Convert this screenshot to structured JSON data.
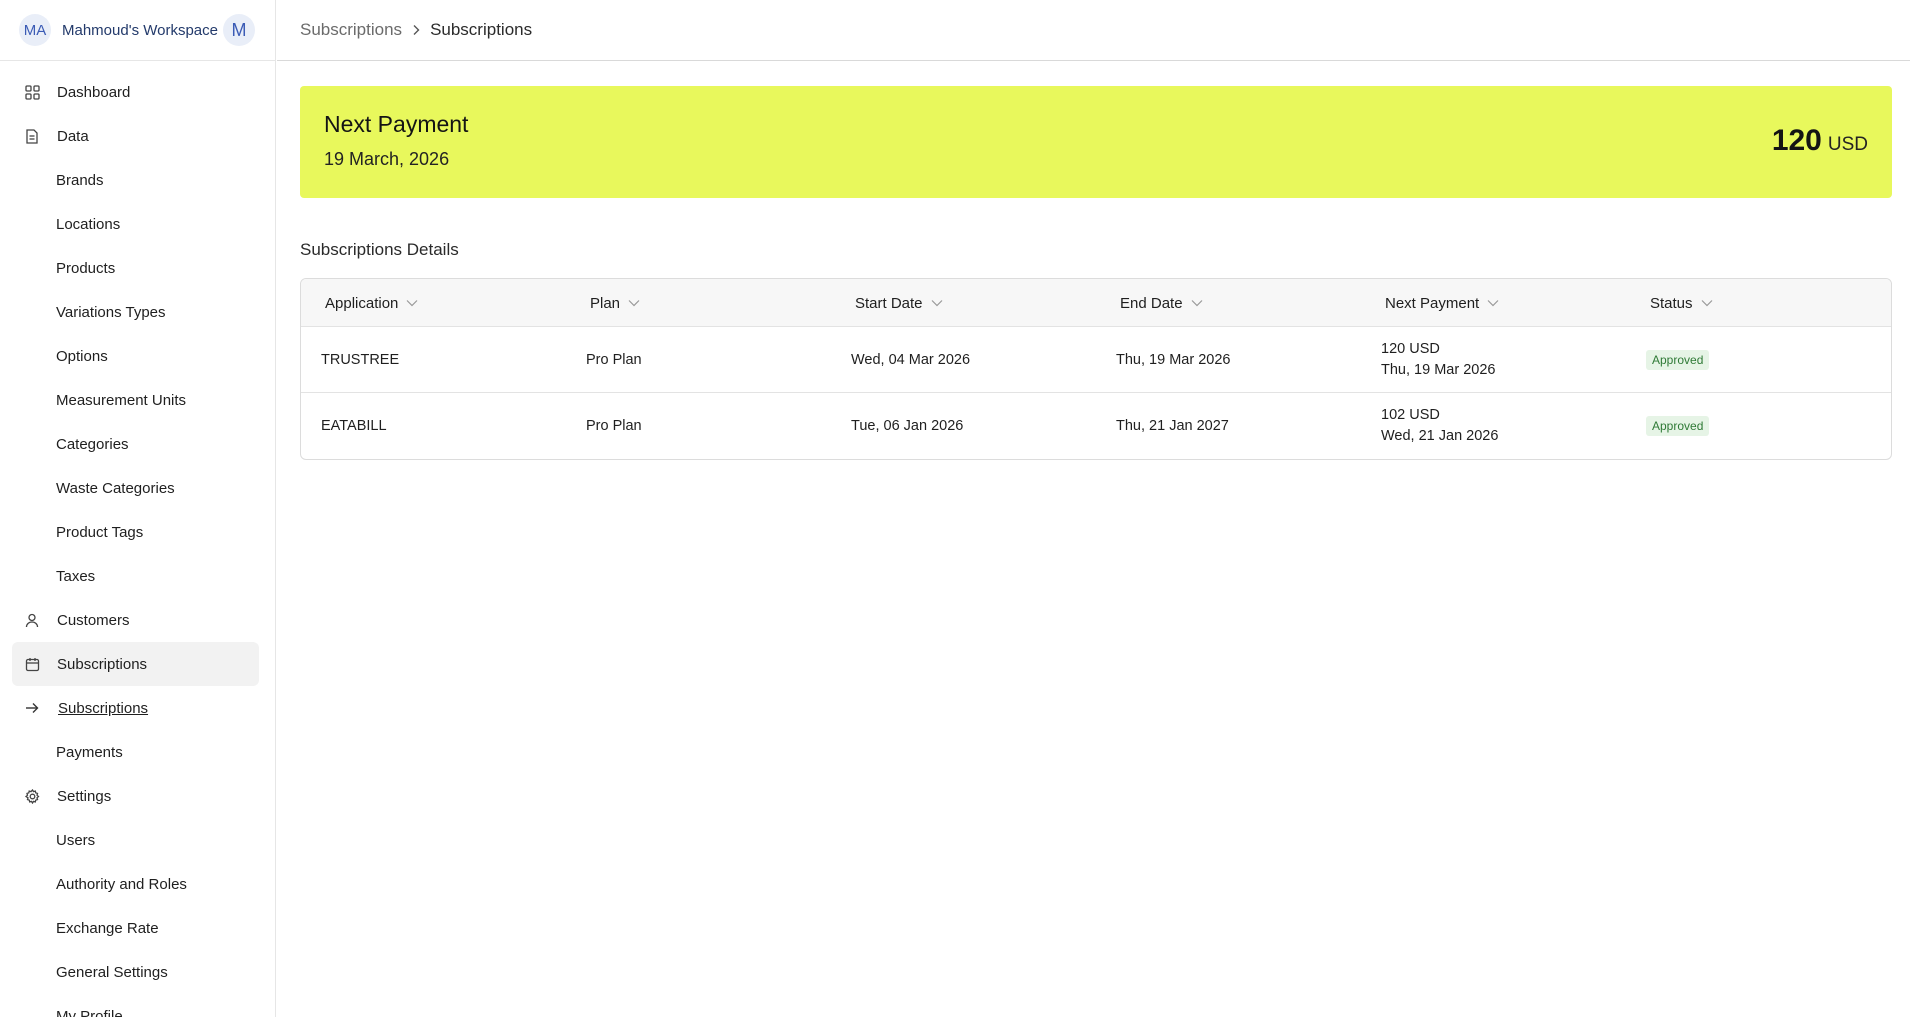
{
  "workspace": {
    "avatar_initials": "MA",
    "name": "Mahmoud's Workspace",
    "user_initial": "M"
  },
  "sidebar": {
    "items": [
      {
        "label": "Dashboard",
        "icon": "grid-icon"
      },
      {
        "label": "Data",
        "icon": "document-icon"
      },
      {
        "label": "Brands"
      },
      {
        "label": "Locations"
      },
      {
        "label": "Products"
      },
      {
        "label": "Variations Types"
      },
      {
        "label": "Options"
      },
      {
        "label": "Measurement Units"
      },
      {
        "label": "Categories"
      },
      {
        "label": "Waste Categories"
      },
      {
        "label": "Product Tags"
      },
      {
        "label": "Taxes"
      },
      {
        "label": "Customers",
        "icon": "user-icon"
      },
      {
        "label": "Subscriptions",
        "icon": "calendar-icon"
      },
      {
        "label": "Subscriptions",
        "icon": "arrow-right-icon"
      },
      {
        "label": "Payments"
      },
      {
        "label": "Settings",
        "icon": "gear-icon"
      },
      {
        "label": "Users"
      },
      {
        "label": "Authority and Roles"
      },
      {
        "label": "Exchange Rate"
      },
      {
        "label": "General Settings"
      },
      {
        "label": "My Profile"
      }
    ]
  },
  "breadcrumb": {
    "parent": "Subscriptions",
    "current": "Subscriptions"
  },
  "next_payment": {
    "title": "Next Payment",
    "date": "19 March, 2026",
    "amount": "120",
    "currency": "USD"
  },
  "details": {
    "title": "Subscriptions Details",
    "columns": [
      "Application",
      "Plan",
      "Start Date",
      "End Date",
      "Next Payment",
      "Status"
    ],
    "rows": [
      {
        "application": "TRUSTREE",
        "plan": "Pro Plan",
        "start_date": "Wed, 04 Mar 2026",
        "end_date": "Thu, 19 Mar 2026",
        "next_amount": "120 USD",
        "next_date": "Thu, 19 Mar 2026",
        "status": "Approved"
      },
      {
        "application": "EATABILL",
        "plan": "Pro Plan",
        "start_date": "Tue, 06 Jan 2026",
        "end_date": "Thu, 21 Jan 2027",
        "next_amount": "102 USD",
        "next_date": "Wed, 21 Jan 2026",
        "status": "Approved"
      }
    ]
  },
  "colors": {
    "banner": "#e8f85c",
    "badge_bg": "#e6f4e6",
    "badge_text": "#2f7a36"
  }
}
